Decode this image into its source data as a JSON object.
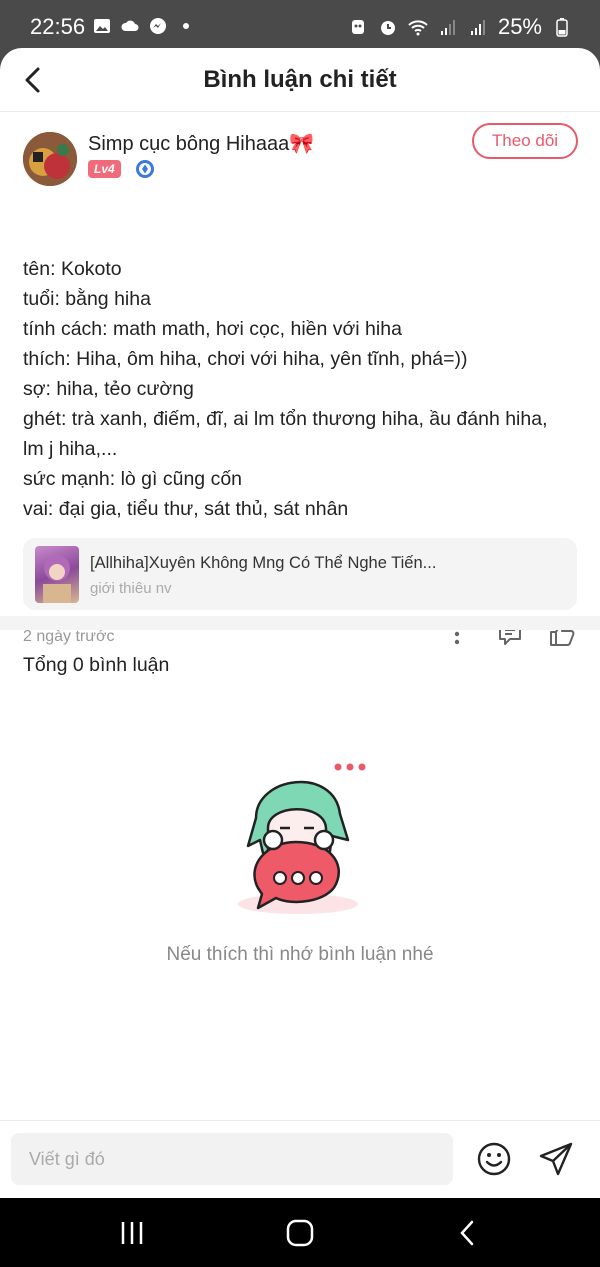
{
  "status_bar": {
    "time": "22:56",
    "battery": "25%"
  },
  "header": {
    "title": "Bình luận chi tiết"
  },
  "post": {
    "author_name": "Simp cục bông Hihaaa🎀",
    "level": "Lv4",
    "follow_label": "Theo dõi",
    "lines": [
      "tên: Kokoto",
      "tuổi: bằng hiha",
      "tính cách: math math, hơi cọc, hiền với hiha",
      "thích: Hiha, ôm hiha, chơi với hiha, yên tĩnh, phá=))",
      "sợ: hiha, tẻo cường",
      "ghét: trà xanh, điếm, đĩ, ai lm tổn thương hiha, ầu đánh hiha,",
      "lm j hiha,...",
      "sức mạnh: lò gì cũng cốn",
      "vai: đại gia, tiểu thư, sát thủ, sát nhân"
    ],
    "book": {
      "title": "[Allhiha]Xuyên Không Mng Có Thể Nghe Tiến...",
      "subtitle": "giới thiêu nv"
    },
    "time": "2 ngày trước"
  },
  "comments": {
    "count_label": "Tổng 0 bình luận",
    "empty_text": "Nếu thích thì nhớ bình luận nhé"
  },
  "input": {
    "placeholder": "Viết gì đó"
  },
  "colors": {
    "accent": "#e85a6a",
    "level_badge": "#f06a7a",
    "status_bar": "#4a4a4a",
    "nav_bar": "#000000"
  }
}
